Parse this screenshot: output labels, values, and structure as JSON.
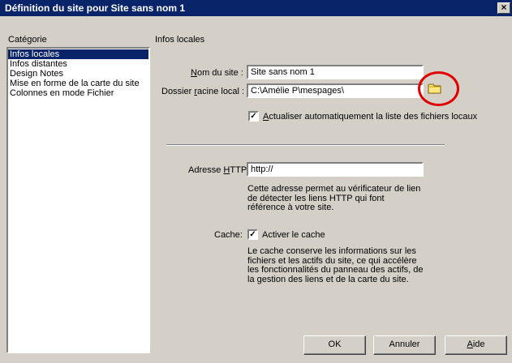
{
  "window": {
    "title": "Définition du site pour  Site sans nom 1",
    "close_glyph": "×"
  },
  "category": {
    "header": "Catégorie",
    "items": [
      "Infos locales",
      "Infos distantes",
      "Design Notes",
      "Mise en forme de la carte du site",
      "Colonnes en mode Fichier"
    ],
    "selected_index": 0
  },
  "panel": {
    "header": "Infos locales",
    "site_name": {
      "label_accel": "N",
      "label_rest": "om du site :",
      "value": "Site sans nom 1"
    },
    "root_folder": {
      "label_pre": "Dossier ",
      "label_accel": "r",
      "label_rest": "acine local :",
      "value": "C:\\Amélie P\\mespages\\",
      "browse_icon": "folder-icon"
    },
    "auto_refresh": {
      "checked": true,
      "check_glyph": "✓",
      "label_accel": "A",
      "label_rest": "ctualiser automatiquement la liste des fichiers locaux"
    },
    "http": {
      "label_pre": "Adresse ",
      "label_accel": "H",
      "label_rest": "TTP :",
      "value": "http://",
      "help": [
        "Cette adresse permet au vérificateur de lien",
        "de détecter les liens HTTP qui font",
        "référence à votre site."
      ]
    },
    "cache": {
      "label": "Cache:",
      "checked": true,
      "check_glyph": "✓",
      "checkbox_label": "Activer le cache",
      "help": [
        "Le cache conserve les informations sur les",
        "fichiers et les actifs du site, ce qui accélère",
        "les fonctionnalités du panneau des actifs, de",
        "la gestion des liens et de la carte du site."
      ]
    }
  },
  "buttons": {
    "ok": "OK",
    "cancel": "Annuler",
    "help_accel": "A",
    "help_rest": "ide"
  },
  "colors": {
    "titlebar": "#0a246a",
    "face": "#d4d0c8",
    "highlight_circle": "#e00000"
  }
}
